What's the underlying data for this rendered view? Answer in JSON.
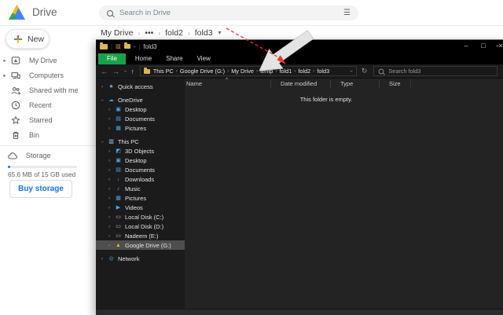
{
  "colors": {
    "explorer_tab_green": "#18a348",
    "drive_link_blue": "#1a73e8",
    "annotation_arrow_red": "#e8392a",
    "selected_tree_row_gray": "#4e4e4e"
  },
  "drive": {
    "app_name": "Drive",
    "search_placeholder": "Search in Drive",
    "new_button_label": "New",
    "breadcrumb": [
      "My Drive",
      "•••",
      "fold2",
      "fold3"
    ],
    "sidebar": [
      {
        "label": "My Drive",
        "icon": "drive",
        "expandable": true
      },
      {
        "label": "Computers",
        "icon": "computers",
        "expandable": true
      },
      {
        "label": "Shared with me",
        "icon": "people",
        "expandable": false
      },
      {
        "label": "Recent",
        "icon": "clock",
        "expandable": false
      },
      {
        "label": "Starred",
        "icon": "star",
        "expandable": false
      },
      {
        "label": "Bin",
        "icon": "trash",
        "expandable": false
      }
    ],
    "storage": {
      "label": "Storage",
      "icon": "cloud",
      "usage": "65.6 MB of 15 GB used",
      "buy_button_label": "Buy storage"
    }
  },
  "explorer": {
    "title": "fold3",
    "window_buttons": [
      "minimize",
      "maximize",
      "close"
    ],
    "ribbon_tabs": [
      "File",
      "Home",
      "Share",
      "View"
    ],
    "address_path": [
      "This PC",
      "Google Drive (G:)",
      "My Drive",
      "temp",
      "fold1",
      "fold2",
      "fold3"
    ],
    "search_placeholder": "Search fold3",
    "columns": [
      "Name",
      "Date modified",
      "Type",
      "Size"
    ],
    "empty_message": "This folder is empty.",
    "tree": [
      {
        "label": "Quick access",
        "icon": "star",
        "level": 0,
        "expanded": false
      },
      {
        "label": "OneDrive",
        "icon": "cloud",
        "level": 0,
        "expanded": true,
        "group_gap": true
      },
      {
        "label": "Desktop",
        "icon": "monitor",
        "level": 1,
        "expanded": false
      },
      {
        "label": "Documents",
        "icon": "doc",
        "level": 1,
        "expanded": false
      },
      {
        "label": "Pictures",
        "icon": "pic",
        "level": 1,
        "expanded": false
      },
      {
        "label": "This PC",
        "icon": "pc",
        "level": 0,
        "expanded": true,
        "group_gap": true
      },
      {
        "label": "3D Objects",
        "icon": "objects3d",
        "level": 1,
        "expanded": false
      },
      {
        "label": "Desktop",
        "icon": "monitor",
        "level": 1,
        "expanded": false
      },
      {
        "label": "Documents",
        "icon": "doc",
        "level": 1,
        "expanded": false
      },
      {
        "label": "Downloads",
        "icon": "down",
        "level": 1,
        "expanded": false
      },
      {
        "label": "Music",
        "icon": "music",
        "level": 1,
        "expanded": false
      },
      {
        "label": "Pictures",
        "icon": "pic",
        "level": 1,
        "expanded": false
      },
      {
        "label": "Videos",
        "icon": "video",
        "level": 1,
        "expanded": false
      },
      {
        "label": "Local Disk (C:)",
        "icon": "disk",
        "level": 1,
        "expanded": false
      },
      {
        "label": "Local Disk (D:)",
        "icon": "disk",
        "level": 1,
        "expanded": false
      },
      {
        "label": "Nadeem (E:)",
        "icon": "disk",
        "level": 1,
        "expanded": false
      },
      {
        "label": "Google Drive (G:)",
        "icon": "gdrive",
        "level": 1,
        "expanded": false,
        "selected": true
      },
      {
        "label": "Network",
        "icon": "network",
        "level": 0,
        "expanded": false,
        "group_gap": true
      }
    ]
  }
}
